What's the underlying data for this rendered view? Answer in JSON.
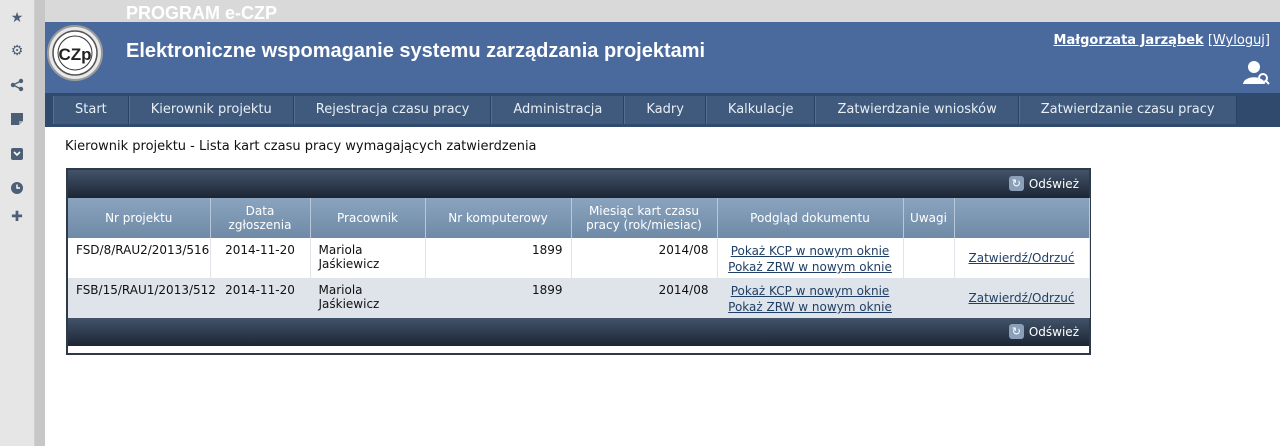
{
  "app": {
    "program_name": "PROGRAM e-CZP",
    "title": "Elektroniczne wspomaganie systemu zarządzania projektami",
    "logo_text": "CZp"
  },
  "user": {
    "name": "Małgorzata Jarząbek",
    "logout": "[Wyloguj]"
  },
  "nav": {
    "items": [
      {
        "label": "Start"
      },
      {
        "label": "Kierownik projektu"
      },
      {
        "label": "Rejestracja czasu pracy"
      },
      {
        "label": "Administracja"
      },
      {
        "label": "Kadry"
      },
      {
        "label": "Kalkulacje"
      },
      {
        "label": "Zatwierdzanie wniosków"
      },
      {
        "label": "Zatwierdzanie czasu pracy"
      }
    ]
  },
  "page_title": "Kierownik projektu - Lista kart czasu pracy wymagających zatwierdzenia",
  "grid": {
    "refresh_label": "Odśwież",
    "columns": [
      "Nr projektu",
      "Data zgłoszenia",
      "Pracownik",
      "Nr komputerowy",
      "Miesiąc kart czasu pracy (rok/miesiac)",
      "Podgląd dokumentu",
      "Uwagi",
      ""
    ],
    "rows": [
      {
        "project": "FSD/8/RAU2/2013/516",
        "date": "2014-11-20",
        "employee": "Mariola Jaśkiewicz",
        "comp_no": "1899",
        "month": "2014/08",
        "link_kcp": "Pokaż KCP w nowym oknie",
        "link_zrw": "Pokaż ZRW w nowym oknie",
        "notes": "",
        "action": "Zatwierdź/Odrzuć"
      },
      {
        "project": "FSB/15/RAU1/2013/512",
        "date": "2014-11-20",
        "employee": "Mariola Jaśkiewicz",
        "comp_no": "1899",
        "month": "2014/08",
        "link_kcp": "Pokaż KCP w nowym oknie",
        "link_zrw": "Pokaż ZRW w nowym oknie",
        "notes": "",
        "action": "Zatwierdź/Odrzuć"
      }
    ]
  },
  "sidebar_icons": [
    "star-icon",
    "gear-icon",
    "share-icon",
    "note-icon",
    "inbox-icon",
    "clock-icon",
    "plus-icon"
  ],
  "colors": {
    "banner": "#4a6a9e",
    "nav": "#2f4a6c",
    "header_row": "#7d97b3",
    "alt_row": "#dfe4ea"
  }
}
